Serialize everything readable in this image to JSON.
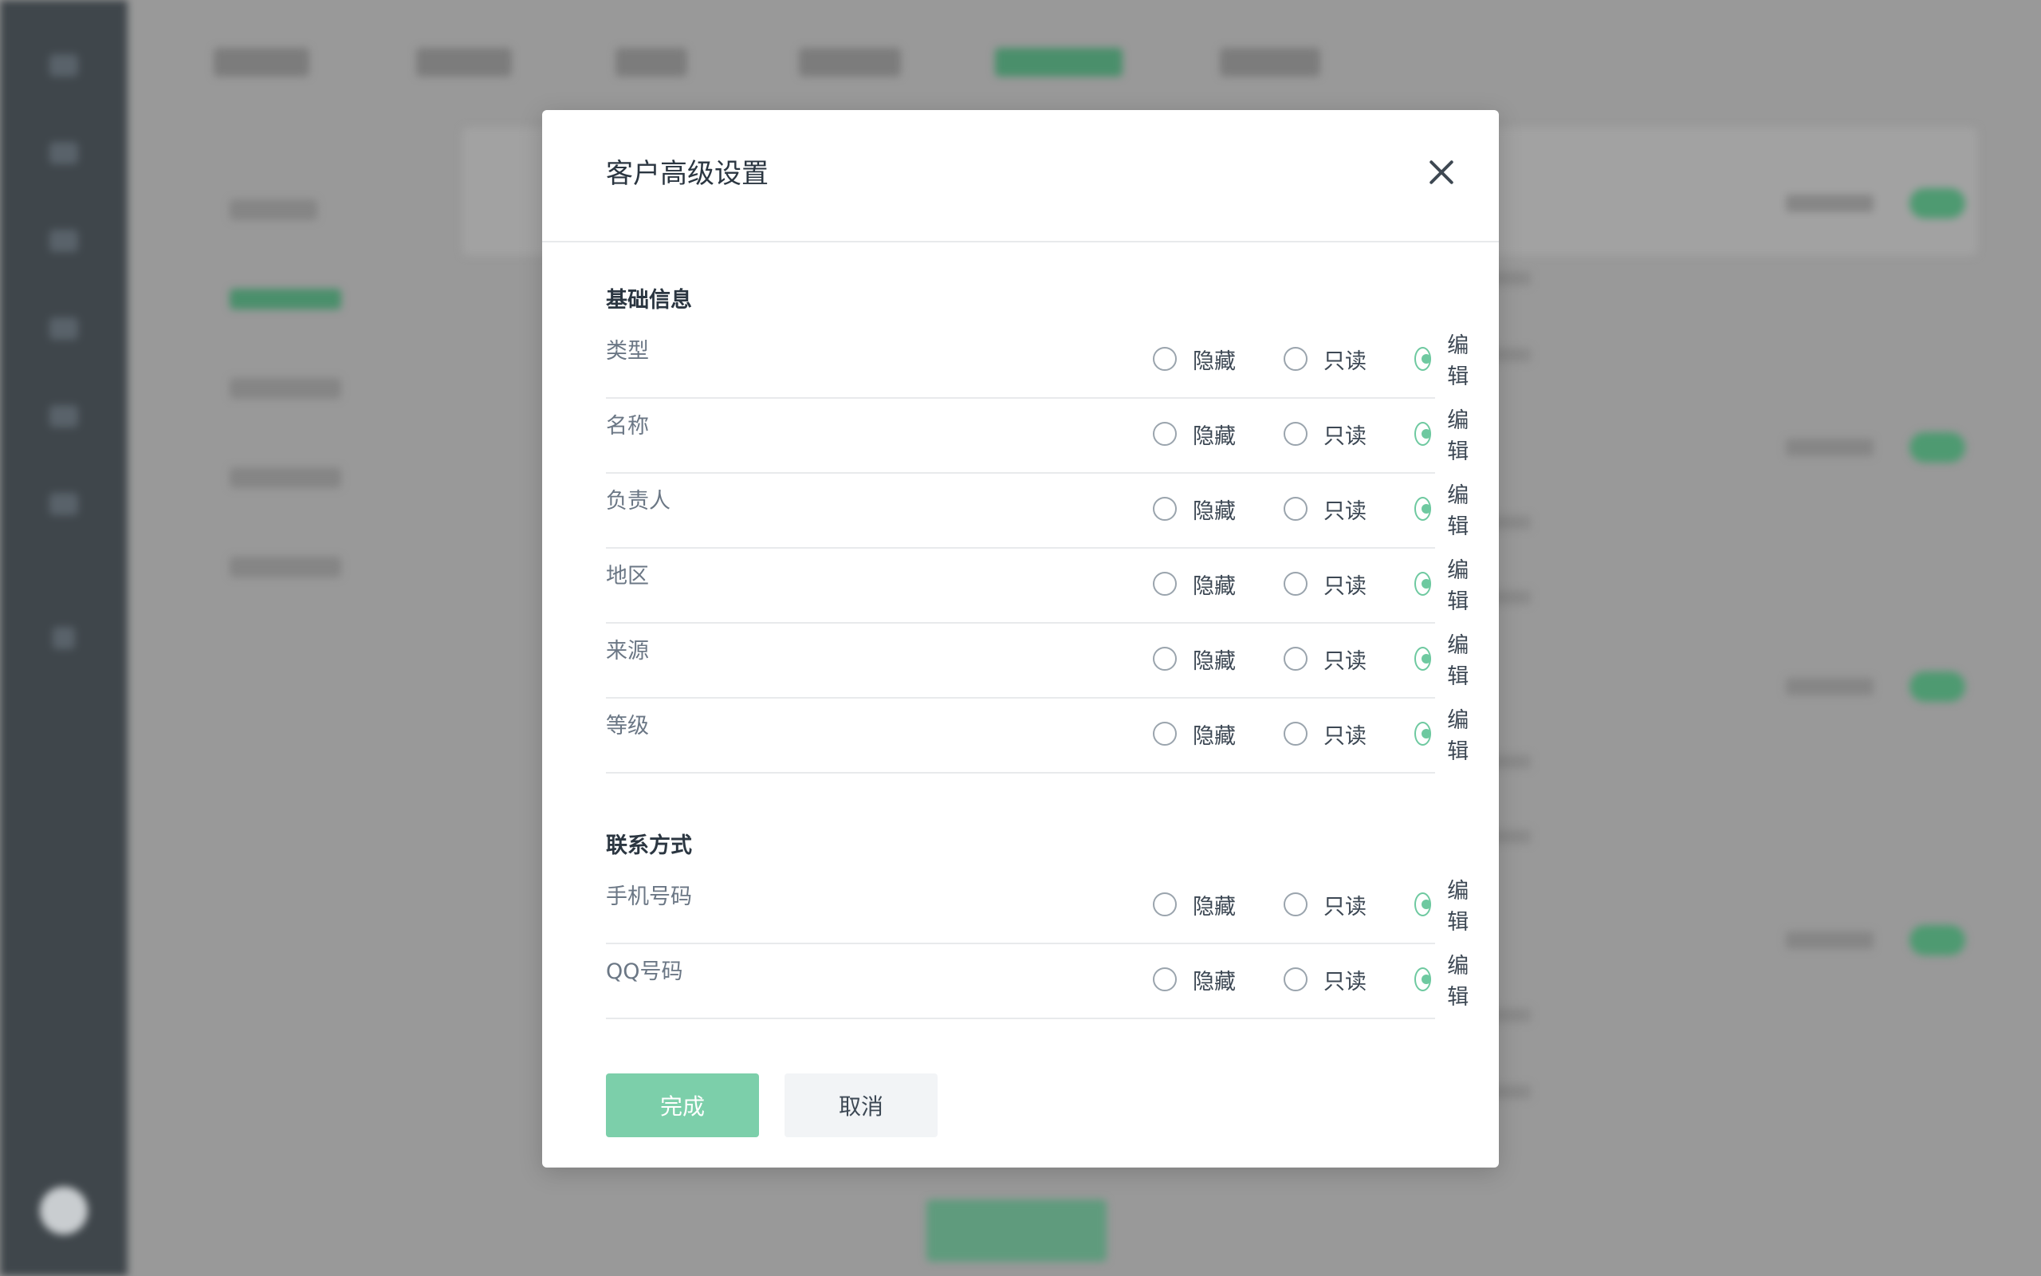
{
  "dialog": {
    "title": "客户高级设置",
    "ok_label": "完成",
    "cancel_label": "取消"
  },
  "options": [
    "隐藏",
    "只读",
    "编辑"
  ],
  "sections": [
    {
      "title": "基础信息",
      "fields": [
        {
          "label": "类型",
          "selected": "编辑"
        },
        {
          "label": "名称",
          "selected": "编辑"
        },
        {
          "label": "负责人",
          "selected": "编辑"
        },
        {
          "label": "地区",
          "selected": "编辑"
        },
        {
          "label": "来源",
          "selected": "编辑"
        },
        {
          "label": "等级",
          "selected": "编辑"
        }
      ]
    },
    {
      "title": "联系方式",
      "fields": [
        {
          "label": "手机号码",
          "selected": "编辑"
        },
        {
          "label": "QQ号码",
          "selected": "编辑"
        }
      ]
    }
  ],
  "colors": {
    "accent": "#6ec9a0",
    "primary_button": "#7ccfaa",
    "overlay": "#999999",
    "sidebar": "#3f464b"
  }
}
